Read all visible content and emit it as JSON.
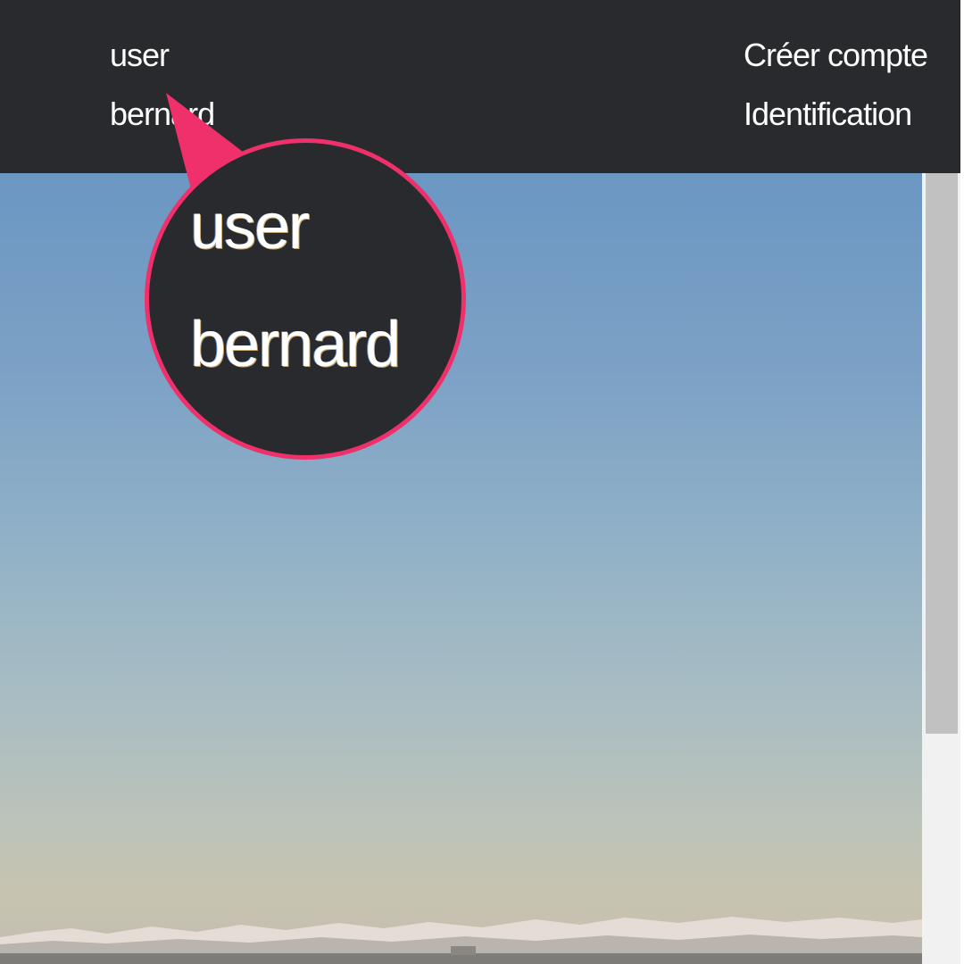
{
  "navbar": {
    "left_links": [
      "user",
      "bernard"
    ],
    "right_links": [
      "Créer compte",
      "Identification"
    ]
  },
  "zoom_callout": {
    "lines": [
      "user",
      "bernard"
    ]
  },
  "colors": {
    "navbar_bg": "#282a2e",
    "annotation_accent": "#f0306a",
    "sky_top": "#6b97c3",
    "sky_bottom": "#c8c3b0"
  }
}
